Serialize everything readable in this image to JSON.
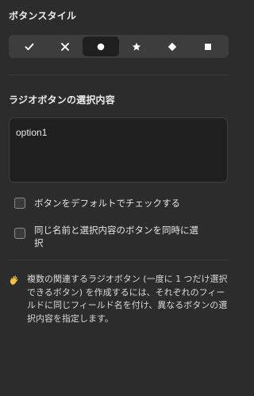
{
  "button_style": {
    "title": "ボタンスタイル",
    "options": [
      {
        "icon": "check-icon",
        "selected": false
      },
      {
        "icon": "cross-icon",
        "selected": false
      },
      {
        "icon": "circle-icon",
        "selected": true
      },
      {
        "icon": "star-icon",
        "selected": false
      },
      {
        "icon": "diamond-icon",
        "selected": false
      },
      {
        "icon": "square-icon",
        "selected": false
      }
    ]
  },
  "radio_value": {
    "title": "ラジオボタンの選択内容",
    "value": "option1"
  },
  "checkboxes": [
    {
      "label": "ボタンをデフォルトでチェックする",
      "checked": false
    },
    {
      "label": "同じ名前と選択内容のボタンを同時に選択",
      "checked": false
    }
  ],
  "info": {
    "icon": "waving-hand-icon",
    "text": "複数の関連するラジオボタン (一度に 1 つだけ選択できるボタン) を作成するには、それぞれのフィールドに同じフィールド名を付け、異なるボタンの選択内容を指定します。"
  },
  "colors": {
    "background": "#2c2c2c",
    "segment_background": "#3d3d3d",
    "segment_selected": "#1f1f1f",
    "input_background": "#1f1f1f",
    "icon": "#ffffff",
    "wave_icon": "#f5c242"
  }
}
